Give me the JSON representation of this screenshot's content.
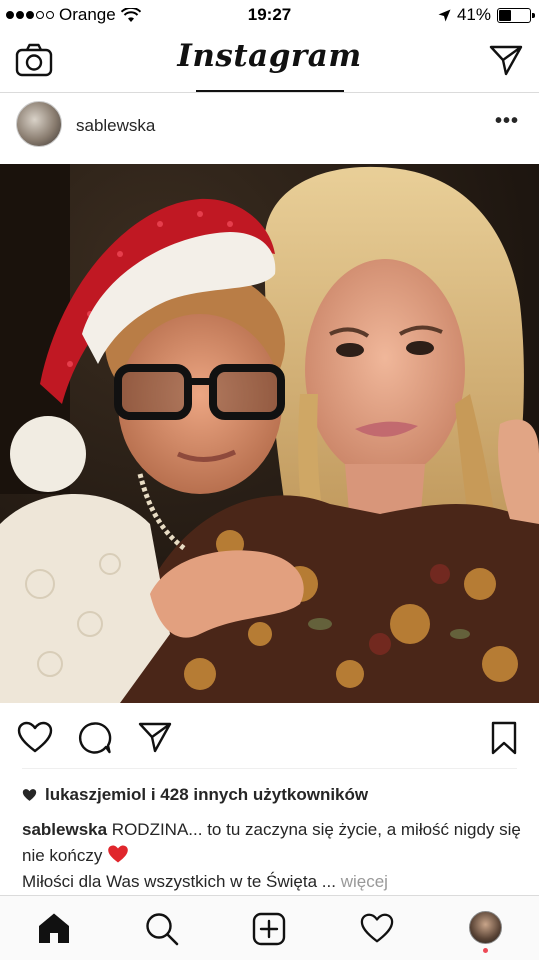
{
  "status_bar": {
    "carrier": "Orange",
    "time": "19:27",
    "battery": "41%",
    "battery_level": 0.41
  },
  "header": {
    "logo": "Instagram"
  },
  "post": {
    "username": "sablewska",
    "photo_description_icon": "photo-image",
    "likes": {
      "liker": "lukaszjemiol",
      "rest": "i 428 innych użytkowników"
    },
    "caption": {
      "user": "sablewska",
      "line1": "RODZINA... to tu zaczyna się życie, a miłość nigdy się nie kończy",
      "line2": "Miłości dla Was wszystkich w te Święta ...",
      "more": "więcej"
    }
  },
  "icons": {
    "camera": "camera-icon",
    "direct": "paper-plane-icon",
    "more": "more-options-icon",
    "like": "heart-icon",
    "comment": "comment-icon",
    "share": "share-icon",
    "save": "bookmark-icon",
    "home": "home-icon",
    "search": "search-icon",
    "add": "add-post-icon",
    "activity": "activity-heart-icon",
    "profile": "profile-avatar"
  },
  "colors": {
    "text": "#262626",
    "muted": "#999999",
    "red_heart": "#ed4956",
    "border": "#dbdbdb"
  }
}
